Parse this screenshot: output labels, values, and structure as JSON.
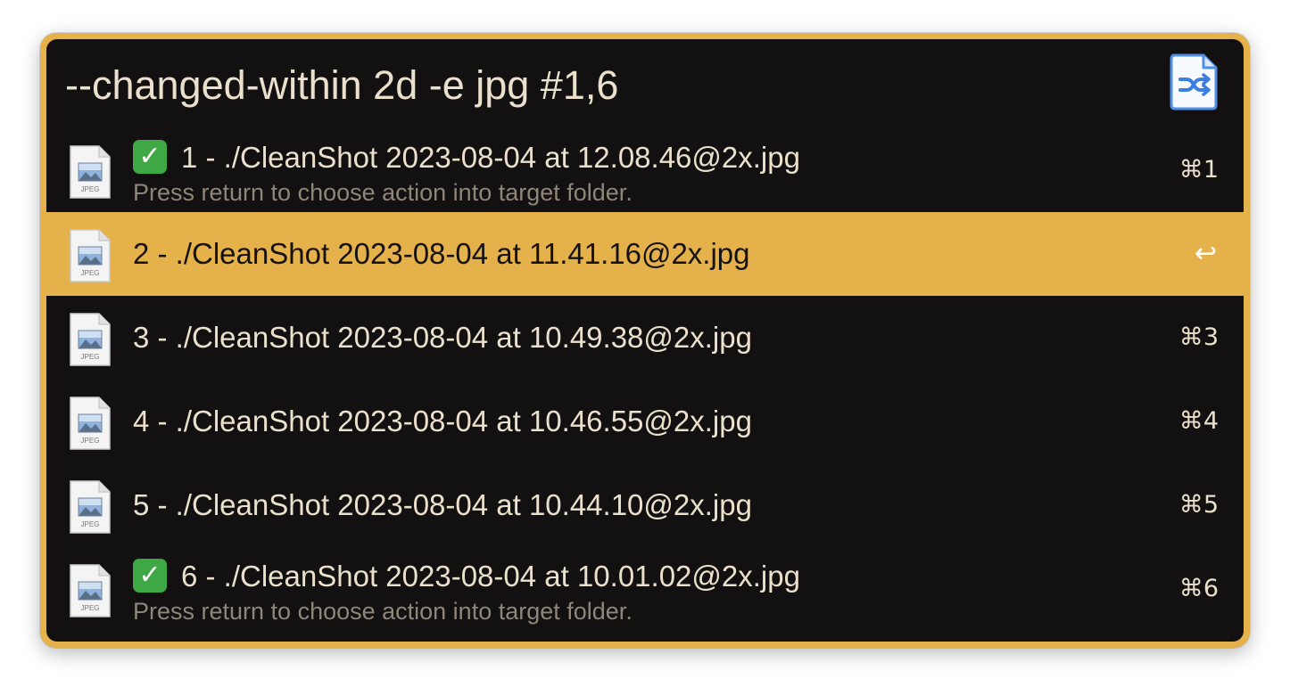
{
  "query": "--changed-within 2d -e jpg #1,6",
  "header_icon": "shuffle-document-icon",
  "file_icon": "jpeg-file-icon",
  "file_icon_label": "JPEG",
  "colors": {
    "accent": "#e5b14a",
    "background": "#121010",
    "text": "#eae0cc",
    "subtext": "#8f8678",
    "check": "#3ea844"
  },
  "results": [
    {
      "index": "1",
      "checked": true,
      "title": "1 - ./CleanShot 2023-08-04 at 12.08.46@2x.jpg",
      "subtitle": "Press return to choose action into target folder.",
      "shortcut": "⌘1",
      "selected": false
    },
    {
      "index": "2",
      "checked": false,
      "title": "2 - ./CleanShot 2023-08-04 at 11.41.16@2x.jpg",
      "subtitle": "",
      "shortcut": "↩",
      "selected": true
    },
    {
      "index": "3",
      "checked": false,
      "title": "3 - ./CleanShot 2023-08-04 at 10.49.38@2x.jpg",
      "subtitle": "",
      "shortcut": "⌘3",
      "selected": false
    },
    {
      "index": "4",
      "checked": false,
      "title": "4 - ./CleanShot 2023-08-04 at 10.46.55@2x.jpg",
      "subtitle": "",
      "shortcut": "⌘4",
      "selected": false
    },
    {
      "index": "5",
      "checked": false,
      "title": "5 - ./CleanShot 2023-08-04 at 10.44.10@2x.jpg",
      "subtitle": "",
      "shortcut": "⌘5",
      "selected": false
    },
    {
      "index": "6",
      "checked": true,
      "title": "6 - ./CleanShot 2023-08-04 at 10.01.02@2x.jpg",
      "subtitle": "Press return to choose action into target folder.",
      "shortcut": "⌘6",
      "selected": false
    }
  ]
}
